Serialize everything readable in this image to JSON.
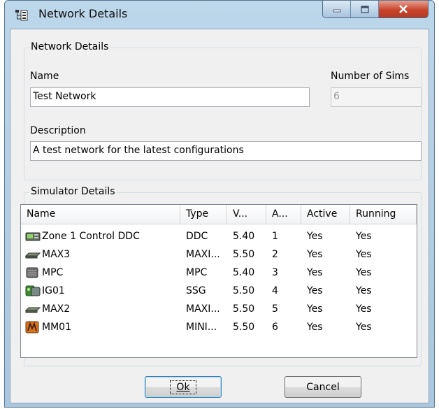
{
  "window": {
    "title": "Network Details",
    "controls": {
      "minimize_icon": "minimize-icon",
      "maximize_icon": "maximize-icon",
      "close_icon": "close-icon"
    }
  },
  "network_group": {
    "legend": "Network Details",
    "name_label": "Name",
    "name_value": "Test Network",
    "sims_label": "Number of Sims",
    "sims_value": "6",
    "description_label": "Description",
    "description_value": "A test network for the latest configurations"
  },
  "simulator_group": {
    "legend": "Simulator Details",
    "columns": [
      "Name",
      "Type",
      "V...",
      "A...",
      "Active",
      "Running"
    ],
    "rows": [
      {
        "icon": "ddc-controller-icon",
        "name": "Zone 1 Control DDC",
        "type": "DDC",
        "version": "5.40",
        "address": "1",
        "active": "Yes",
        "running": "Yes"
      },
      {
        "icon": "maxi-module-icon",
        "name": "MAX3",
        "type": "MAXI...",
        "version": "5.50",
        "address": "2",
        "active": "Yes",
        "running": "Yes"
      },
      {
        "icon": "mpc-module-icon",
        "name": "MPC",
        "type": "MPC",
        "version": "5.40",
        "address": "3",
        "active": "Yes",
        "running": "Yes"
      },
      {
        "icon": "ssg-gateway-icon",
        "name": "IG01",
        "type": "SSG",
        "version": "5.50",
        "address": "4",
        "active": "Yes",
        "running": "Yes"
      },
      {
        "icon": "maxi-module-icon",
        "name": "MAX2",
        "type": "MAXI...",
        "version": "5.50",
        "address": "5",
        "active": "Yes",
        "running": "Yes"
      },
      {
        "icon": "mini-module-icon",
        "name": "MM01",
        "type": "MINI...",
        "version": "5.50",
        "address": "6",
        "active": "Yes",
        "running": "Yes"
      }
    ]
  },
  "buttons": {
    "ok": "Ok",
    "cancel": "Cancel"
  }
}
